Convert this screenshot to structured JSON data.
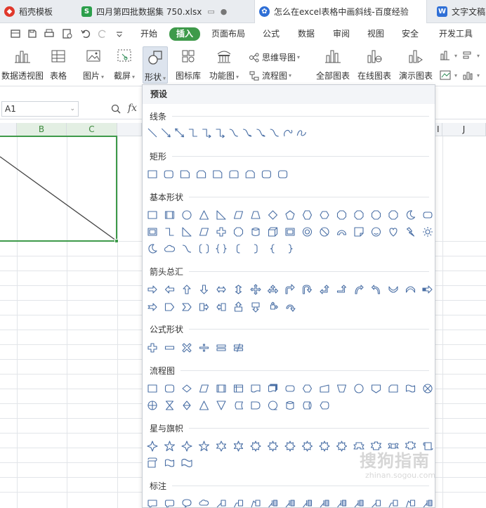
{
  "tabs": [
    {
      "label": "稻壳模板",
      "icon": "daoke-logo-icon",
      "color": "#e0382b"
    },
    {
      "label": "四月第四批数据集 750.xlsx",
      "icon": "spreadsheet-s-icon",
      "color": "#2c9f4b"
    },
    {
      "label": "怎么在excel表格中画斜线-百度经验",
      "icon": "baidu-paw-icon",
      "color": "#2f6fd6"
    },
    {
      "label": "文字文稿",
      "icon": "writer-w-icon",
      "color": "#2f6fd6"
    }
  ],
  "menu": [
    "开始",
    "插入",
    "页面布局",
    "公式",
    "数据",
    "审阅",
    "视图",
    "安全",
    "开发工具"
  ],
  "menu_active": "插入",
  "ribbon": {
    "pivot": "数据透视图",
    "table": "表格",
    "picture": "图片",
    "screenshot": "截屏",
    "shapes": "形状",
    "iconlib": "图标库",
    "funcchart": "功能图",
    "mindmap": "思维导图",
    "flowchart": "流程图",
    "allcharts": "全部图表",
    "onlinechart": "在线图表",
    "demochart": "演示图表"
  },
  "formula": {
    "cell_ref": "A1",
    "fx": "fx"
  },
  "columns": [
    "B",
    "C",
    "I",
    "J"
  ],
  "panel": {
    "title": "预设",
    "sections": [
      "线条",
      "矩形",
      "基本形状",
      "箭头总汇",
      "公式形状",
      "流程图",
      "星与旗帜",
      "标注"
    ]
  },
  "watermark": {
    "main": "搜狗指南",
    "sub": "zhinan.sogou.com"
  },
  "colors": {
    "accent": "#3e9a4a",
    "shape_stroke": "#4a6fa5"
  }
}
